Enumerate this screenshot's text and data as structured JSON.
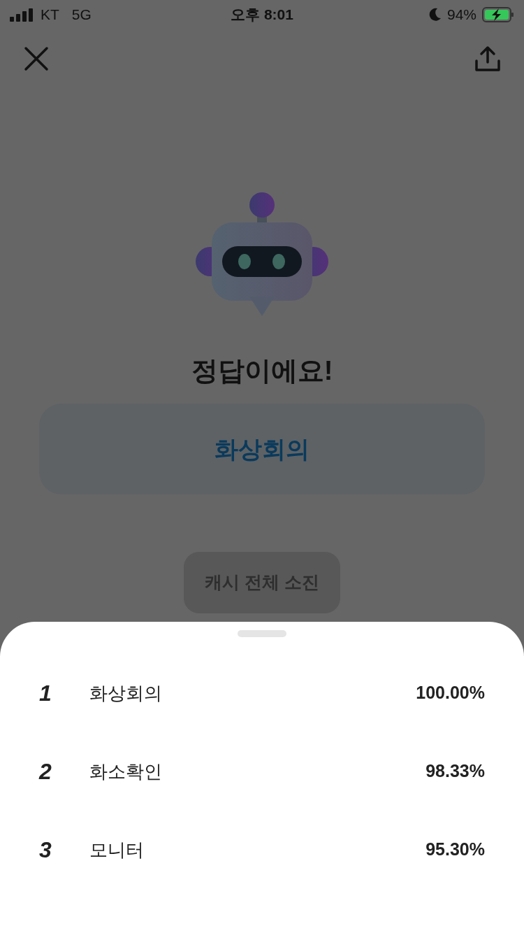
{
  "status_bar": {
    "carrier": "KT",
    "network": "5G",
    "time": "오후 8:01",
    "battery": "94%"
  },
  "result": {
    "title": "정답이에요!",
    "answer": "화상회의",
    "button": "캐시 전체 소진"
  },
  "ranking": [
    {
      "rank": "1",
      "word": "화상회의",
      "score": "100.00%"
    },
    {
      "rank": "2",
      "word": "화소확인",
      "score": "98.33%"
    },
    {
      "rank": "3",
      "word": "모니터",
      "score": "95.30%"
    }
  ]
}
